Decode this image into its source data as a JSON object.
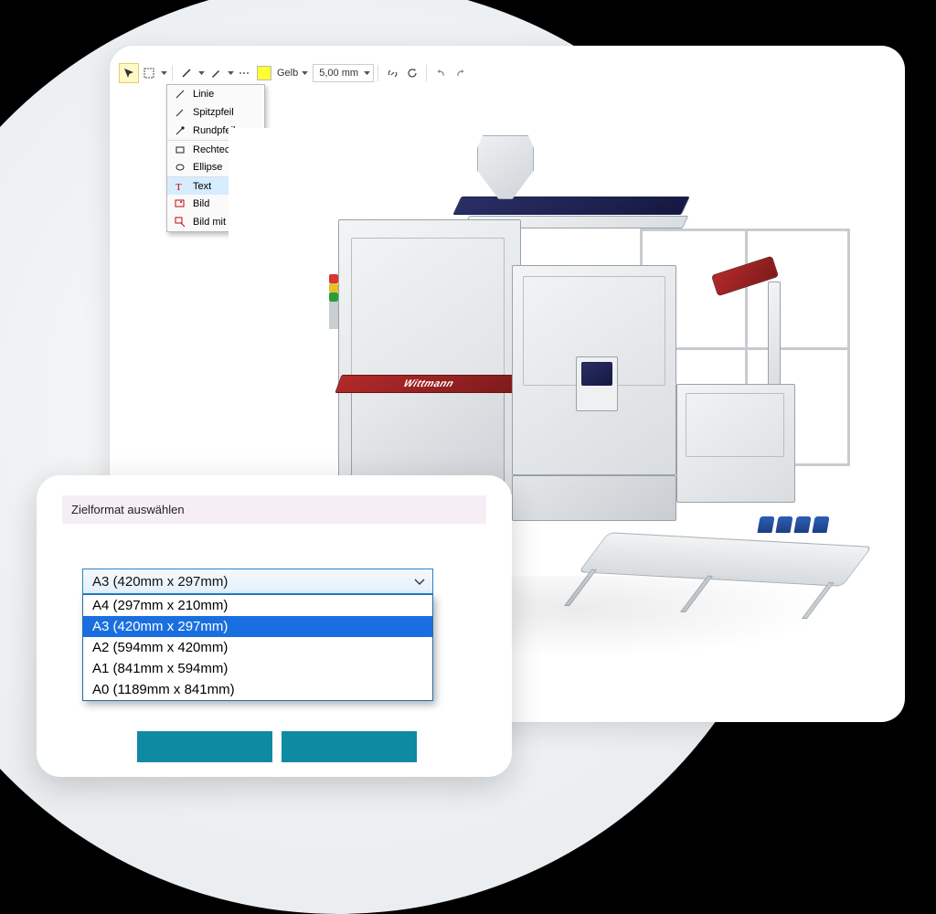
{
  "toolbar": {
    "color_label": "Gelb",
    "stroke_value": "5,00 mm",
    "icons": {
      "pointer": "pointer",
      "marquee": "marquee",
      "shape": "line",
      "pen": "pen",
      "dash": "dash",
      "link": "link",
      "refresh": "refresh",
      "undo": "undo",
      "redo": "redo"
    }
  },
  "shape_menu": {
    "items": [
      "Linie",
      "Spitzpfeil",
      "Rundpfeil",
      "Rechteck",
      "Ellipse",
      "Text",
      "Bild",
      "Bild mit Pfeil"
    ],
    "highlight_index": 5
  },
  "canvas": {
    "brand_label": "Wittmann"
  },
  "format_dialog": {
    "title": "Zielformat auswählen",
    "selected": "A3 (420mm x 297mm)",
    "options": [
      "A4 (297mm x 210mm)",
      "A3 (420mm x 297mm)",
      "A2 (594mm x 420mm)",
      "A1 (841mm x 594mm)",
      "A0 (1189mm x 841mm)"
    ],
    "list_selected_index": 1
  }
}
